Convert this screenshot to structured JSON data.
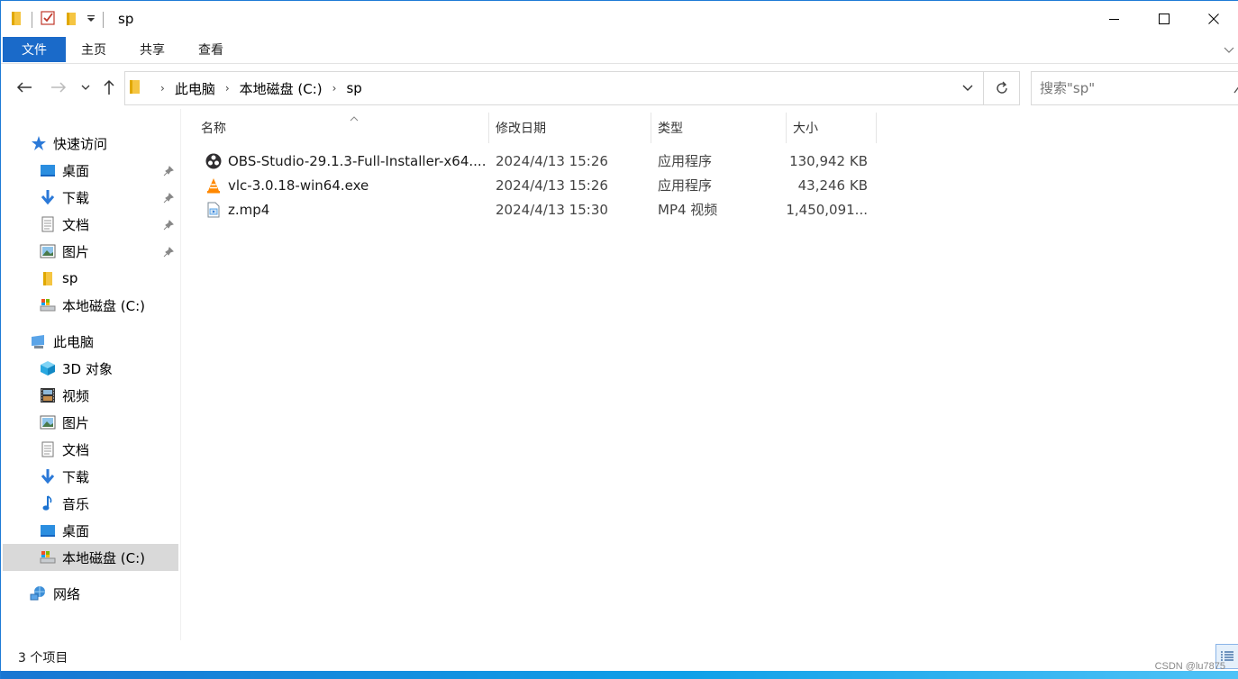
{
  "window": {
    "title": "sp",
    "controls": [
      "minimize",
      "maximize",
      "close"
    ]
  },
  "ribbon": {
    "file_tab": "文件",
    "tabs": [
      "主页",
      "共享",
      "查看"
    ]
  },
  "address": {
    "crumbs": [
      "此电脑",
      "本地磁盘 (C:)",
      "sp"
    ],
    "search_placeholder": "搜索\"sp\""
  },
  "sidebar": {
    "quick_access": "快速访问",
    "quick_items": [
      {
        "label": "桌面",
        "icon": "desktop-icon",
        "pinned": true
      },
      {
        "label": "下载",
        "icon": "download-icon",
        "pinned": true
      },
      {
        "label": "文档",
        "icon": "document-icon",
        "pinned": true
      },
      {
        "label": "图片",
        "icon": "pictures-icon",
        "pinned": true
      },
      {
        "label": "sp",
        "icon": "folder-icon",
        "pinned": false
      },
      {
        "label": "本地磁盘 (C:)",
        "icon": "drive-icon",
        "pinned": false
      }
    ],
    "this_pc": "此电脑",
    "pc_items": [
      {
        "label": "3D 对象",
        "icon": "3d-objects-icon"
      },
      {
        "label": "视频",
        "icon": "video-icon"
      },
      {
        "label": "图片",
        "icon": "pictures-icon"
      },
      {
        "label": "文档",
        "icon": "document-icon"
      },
      {
        "label": "下载",
        "icon": "download-icon"
      },
      {
        "label": "音乐",
        "icon": "music-icon"
      },
      {
        "label": "桌面",
        "icon": "desktop-icon"
      },
      {
        "label": "本地磁盘 (C:)",
        "icon": "drive-icon",
        "selected": true
      }
    ],
    "network": "网络"
  },
  "columns": [
    "名称",
    "修改日期",
    "类型",
    "大小"
  ],
  "files": [
    {
      "name": "OBS-Studio-29.1.3-Full-Installer-x64....",
      "modified": "2024/4/13 15:26",
      "type": "应用程序",
      "size": "130,942 KB",
      "icon": "obs-icon"
    },
    {
      "name": "vlc-3.0.18-win64.exe",
      "modified": "2024/4/13 15:26",
      "type": "应用程序",
      "size": "43,246 KB",
      "icon": "vlc-icon"
    },
    {
      "name": "z.mp4",
      "modified": "2024/4/13 15:30",
      "type": "MP4 视频",
      "size": "1,450,091...",
      "icon": "video-file-icon"
    }
  ],
  "status": {
    "item_count": "3 个项目"
  },
  "watermark": "CSDN @lu7875"
}
